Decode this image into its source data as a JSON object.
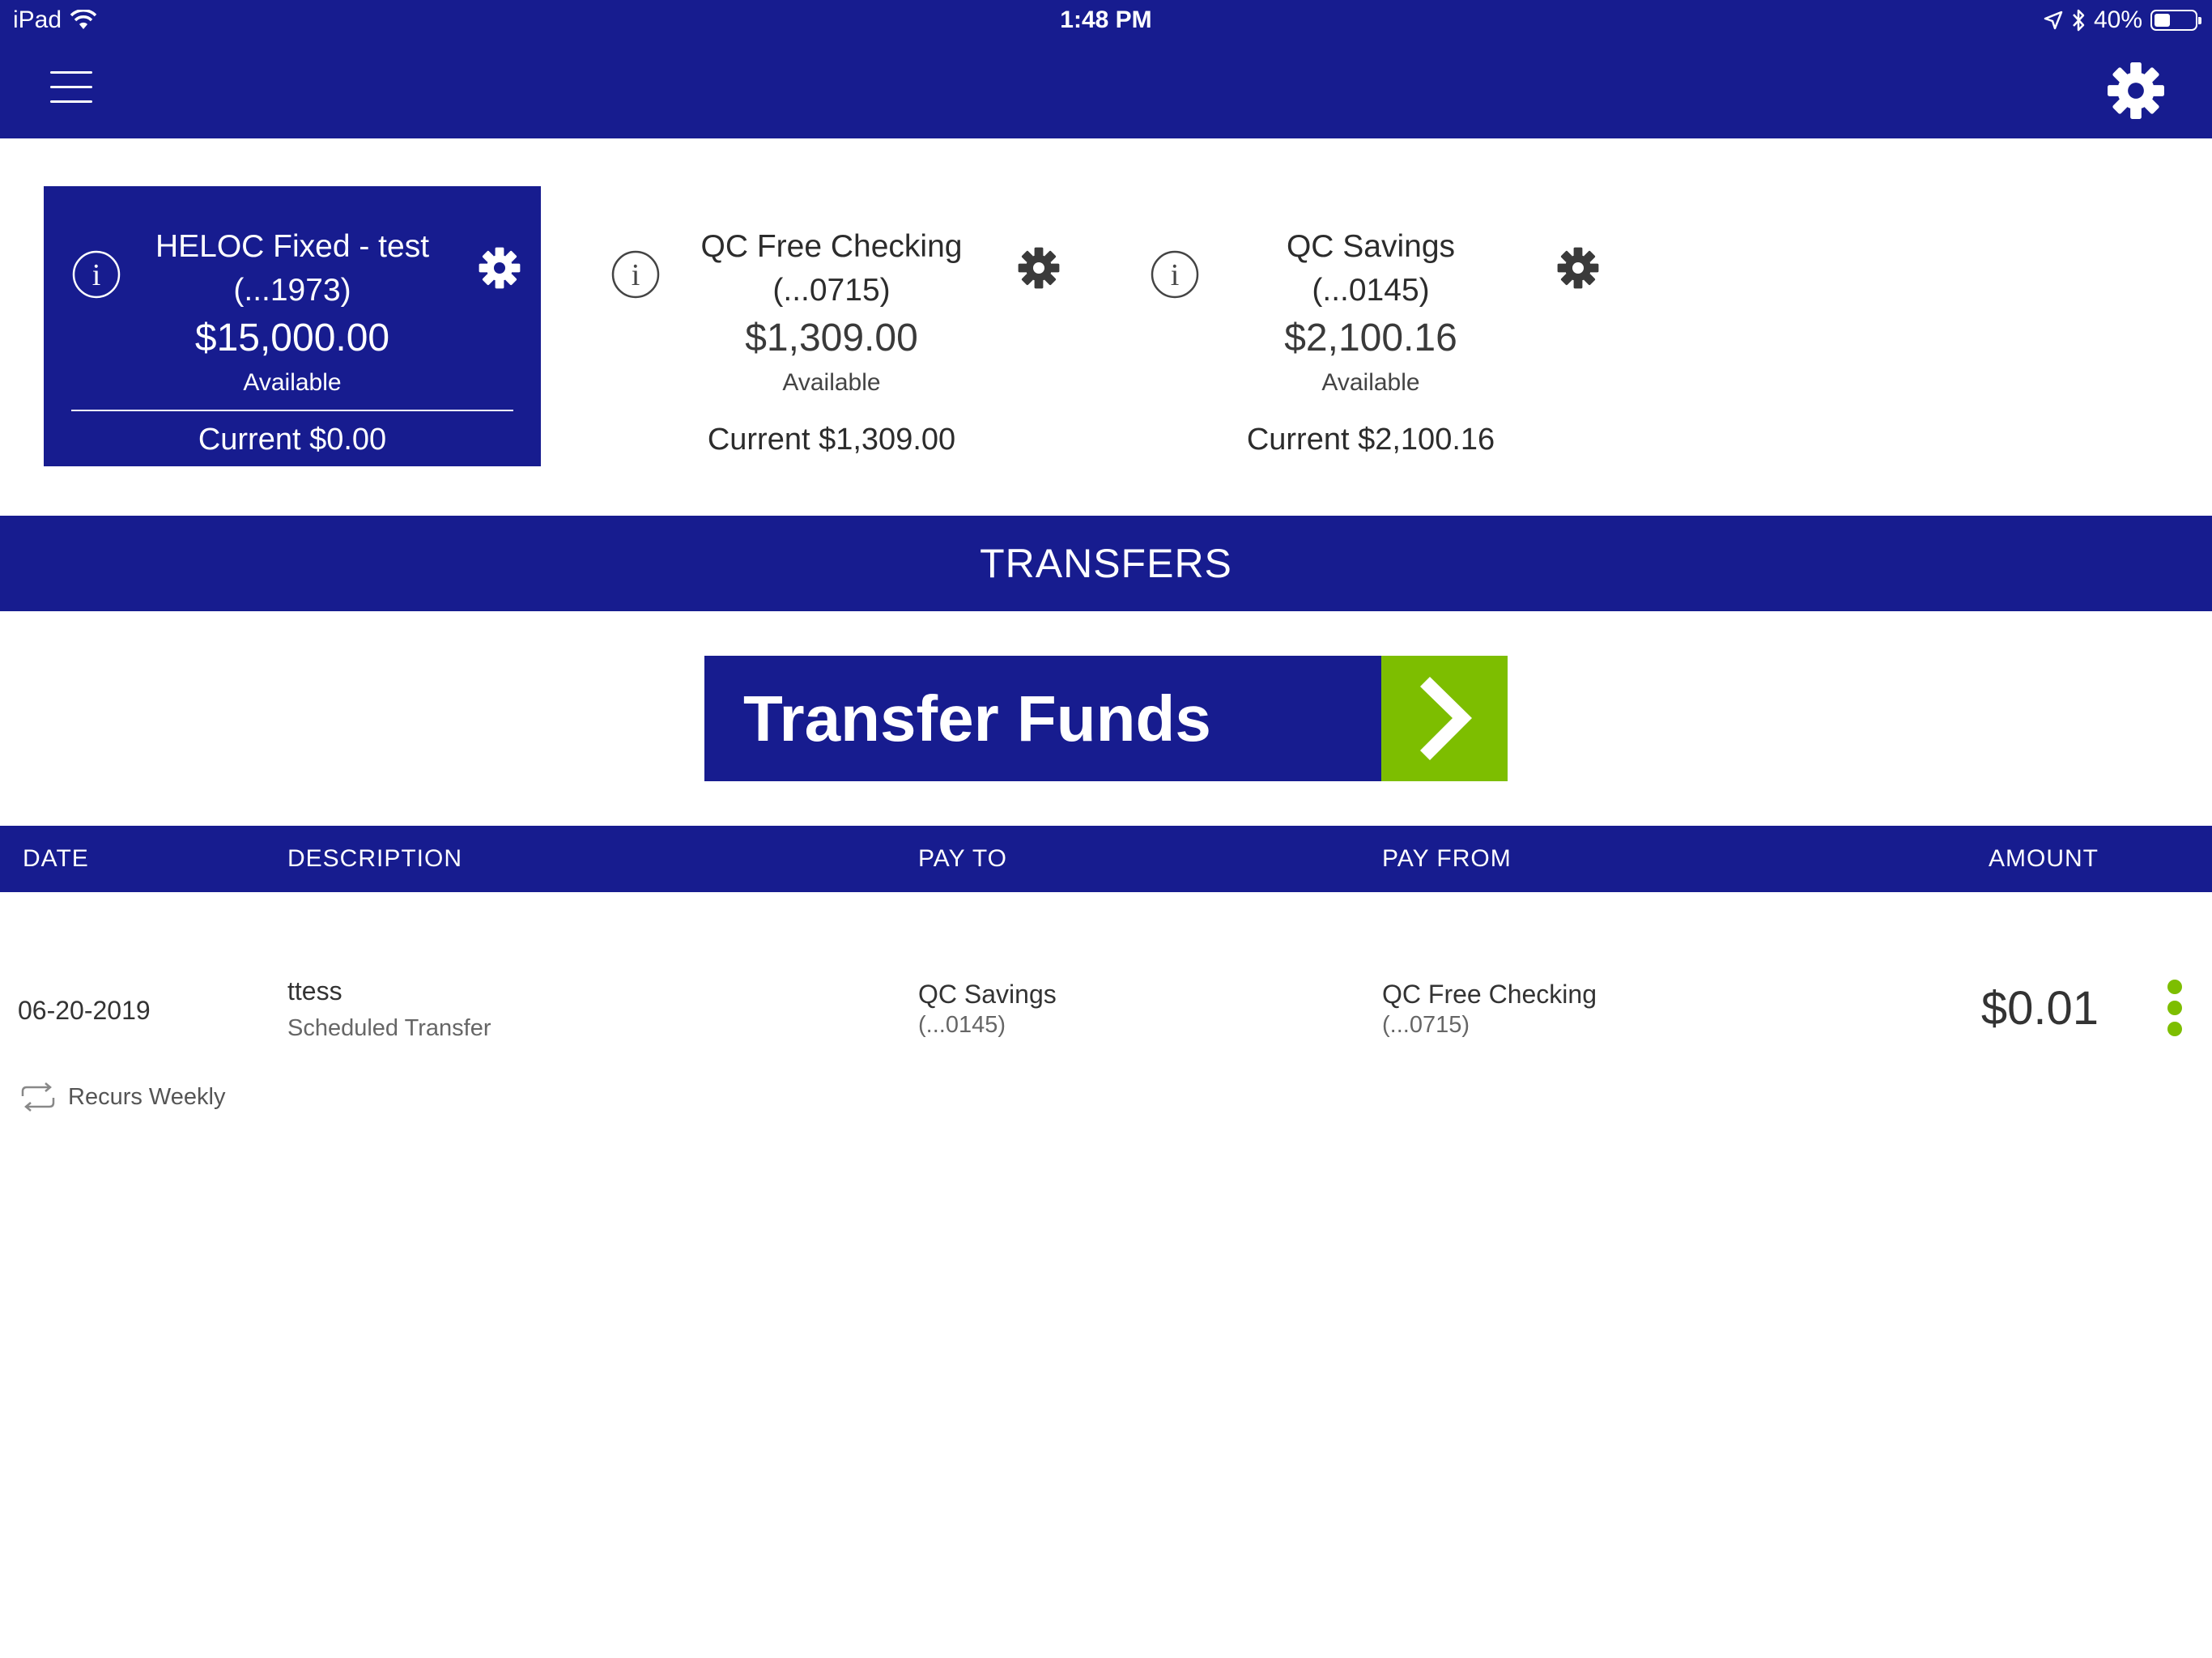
{
  "status_bar": {
    "device": "iPad",
    "time": "1:48 PM",
    "battery": "40%",
    "battery_level": 0.4
  },
  "header": {
    "menu_icon": "hamburger-menu-icon",
    "settings_icon": "gear-icon"
  },
  "accounts": [
    {
      "name": "HELOC Fixed - test",
      "number": "(...1973)",
      "balance": "$15,000.00",
      "available_label": "Available",
      "current": "Current $0.00",
      "selected": true
    },
    {
      "name": "QC Free Checking",
      "number": "(...0715)",
      "balance": "$1,309.00",
      "available_label": "Available",
      "current": "Current $1,309.00",
      "selected": false
    },
    {
      "name": "QC Savings",
      "number": "(...0145)",
      "balance": "$2,100.16",
      "available_label": "Available",
      "current": "Current $2,100.16",
      "selected": false
    }
  ],
  "section_title": "TRANSFERS",
  "transfer_button": {
    "label": "Transfer Funds",
    "icon": "chevron-right-icon"
  },
  "table": {
    "columns": [
      "DATE",
      "DESCRIPTION",
      "PAY TO",
      "PAY FROM",
      "AMOUNT"
    ],
    "rows": [
      {
        "date": "06-20-2019",
        "description": "ttess",
        "description_sub": "Scheduled Transfer",
        "pay_to": "QC Savings",
        "pay_to_sub": "(...0145)",
        "pay_from": "QC Free Checking",
        "pay_from_sub": "(...0715)",
        "amount": "$0.01",
        "recurrence": "Recurs Weekly"
      }
    ]
  },
  "colors": {
    "brand_blue": "#171c8f",
    "accent_green": "#7dbe00",
    "white": "#ffffff"
  }
}
